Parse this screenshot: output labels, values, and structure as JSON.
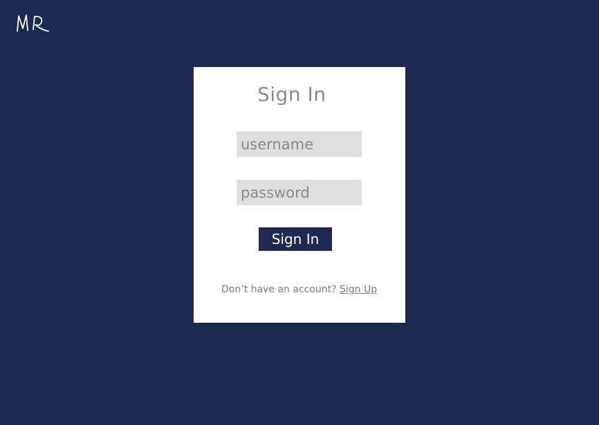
{
  "logo": {
    "text": "MR"
  },
  "login": {
    "title": "Sign In",
    "username_placeholder": "username",
    "password_placeholder": "password",
    "submit_label": "Sign In",
    "signup_prompt": "Don’t have an account?",
    "signup_link": "Sign Up"
  },
  "colors": {
    "background": "#1c2951",
    "card": "#ffffff",
    "input_bg": "#dedede",
    "button": "#1c2951",
    "muted_text": "#8a8a8a"
  }
}
